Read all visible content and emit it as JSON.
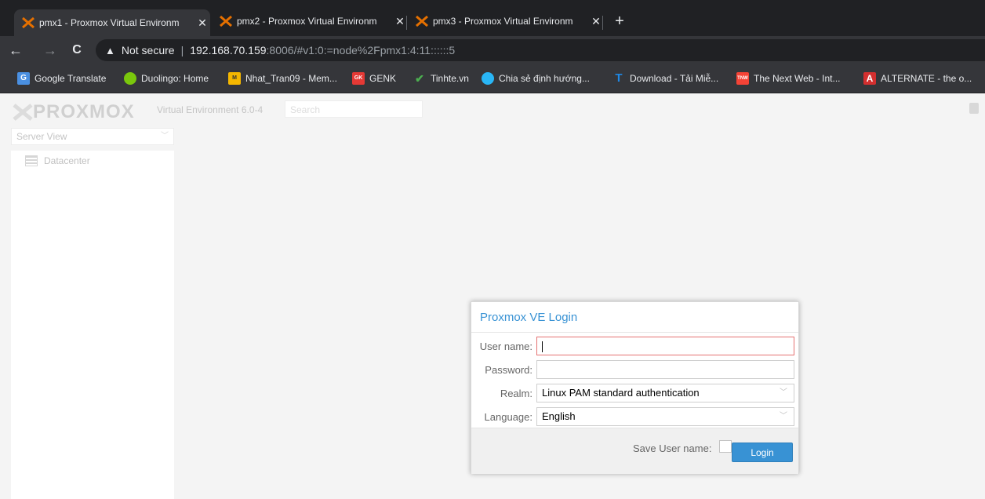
{
  "browser": {
    "tabs": [
      {
        "title": "pmx1 - Proxmox Virtual Environm",
        "close": "✕",
        "active": true
      },
      {
        "title": "pmx2 - Proxmox Virtual Environm",
        "close": "✕",
        "active": false
      },
      {
        "title": "pmx3 - Proxmox Virtual Environm",
        "close": "✕",
        "active": false
      }
    ],
    "new_tab": "+",
    "nav": {
      "back": "←",
      "forward": "→",
      "reload": "C"
    },
    "address": {
      "warning_icon": "▲",
      "security_label": "Not secure",
      "separator": "|",
      "host": "192.168.70.159",
      "path": ":8006/#v1:0:=node%2Fpmx1:4:11::::::5"
    },
    "bookmarks": [
      {
        "label": "Google Translate",
        "icon": "google-translate-icon",
        "color": "#4a90e2"
      },
      {
        "label": "Duolingo: Home",
        "icon": "duolingo-icon",
        "color": "#7ac70c"
      },
      {
        "label": "Nhat_Tran09 - Mem...",
        "icon": "memrise-icon",
        "color": "#f5b700"
      },
      {
        "label": "GENK",
        "icon": "genk-icon",
        "color": "#e53935"
      },
      {
        "label": "Tinhte.vn",
        "icon": "tinhte-icon",
        "color": "#4caf50"
      },
      {
        "label": "Chia sẻ định hướng...",
        "icon": "globe-icon",
        "color": "#29b6f6"
      },
      {
        "label": "Download - Tải Miễ...",
        "icon": "t-letter-icon",
        "color": "#1e88e5"
      },
      {
        "label": "The Next Web - Int...",
        "icon": "tnw-icon",
        "color": "#f44336"
      },
      {
        "label": "ALTERNATE - the o...",
        "icon": "alternate-icon",
        "color": "#d32f2f"
      }
    ]
  },
  "proxmox": {
    "logo": "PROXMOX",
    "version": "Virtual Environment 6.0-4",
    "search_placeholder": "Search",
    "server_view": "Server View",
    "tree_root": "Datacenter"
  },
  "login": {
    "title": "Proxmox VE Login",
    "username_label": "User name:",
    "username_value": "",
    "password_label": "Password:",
    "realm_label": "Realm:",
    "realm_value": "Linux PAM standard authentication",
    "language_label": "Language:",
    "language_value": "English",
    "save_username_label": "Save User name:",
    "save_username_checked": false,
    "login_button": "Login"
  },
  "colors": {
    "accent": "#3892d4",
    "focus_border": "#e57373",
    "logo_orange": "#e57000"
  }
}
